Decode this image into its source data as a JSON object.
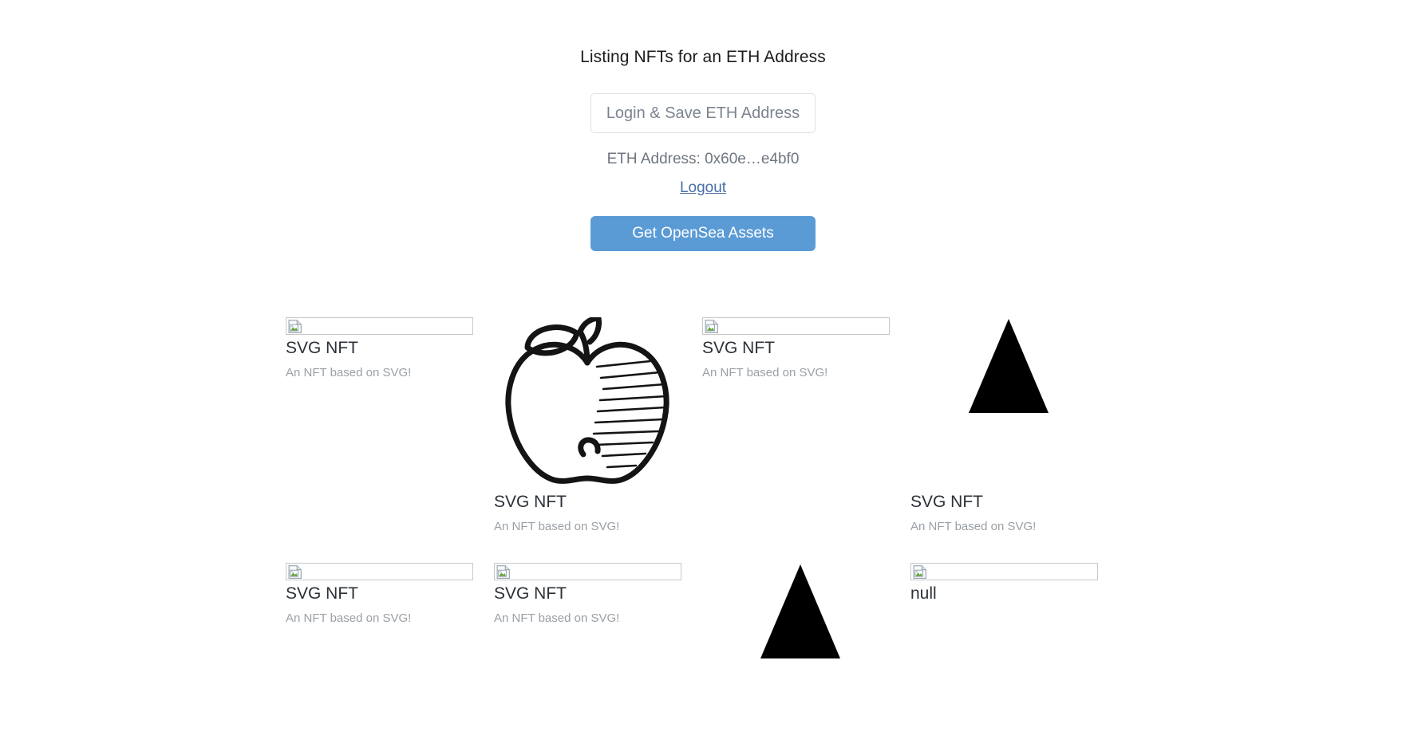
{
  "page": {
    "title": "Listing NFTs for an ETH Address"
  },
  "auth": {
    "login_button_label": "Login & Save ETH Address",
    "eth_address_label": "ETH Address: 0x60e…e4bf0",
    "logout_link_label": "Logout"
  },
  "actions": {
    "get_assets_label": "Get OpenSea Assets"
  },
  "colors": {
    "primary_button": "#5b9bd5",
    "link": "#4a6fa5",
    "muted_text": "#9aa0a6",
    "title_text": "#1c1c1c"
  },
  "nfts": [
    {
      "media": "broken-image",
      "title": "SVG NFT",
      "description": "An NFT based on SVG!"
    },
    {
      "media": "apple-svg",
      "title": "SVG NFT",
      "description": "An NFT based on SVG!"
    },
    {
      "media": "broken-image",
      "title": "SVG NFT",
      "description": "An NFT based on SVG!"
    },
    {
      "media": "triangle-svg",
      "title": "SVG NFT",
      "description": "An NFT based on SVG!"
    },
    {
      "media": "broken-image",
      "title": "SVG NFT",
      "description": "An NFT based on SVG!"
    },
    {
      "media": "broken-image",
      "title": "SVG NFT",
      "description": "An NFT based on SVG!"
    },
    {
      "media": "triangle-svg",
      "title": "",
      "description": ""
    },
    {
      "media": "broken-image",
      "title": "null",
      "description": ""
    }
  ]
}
